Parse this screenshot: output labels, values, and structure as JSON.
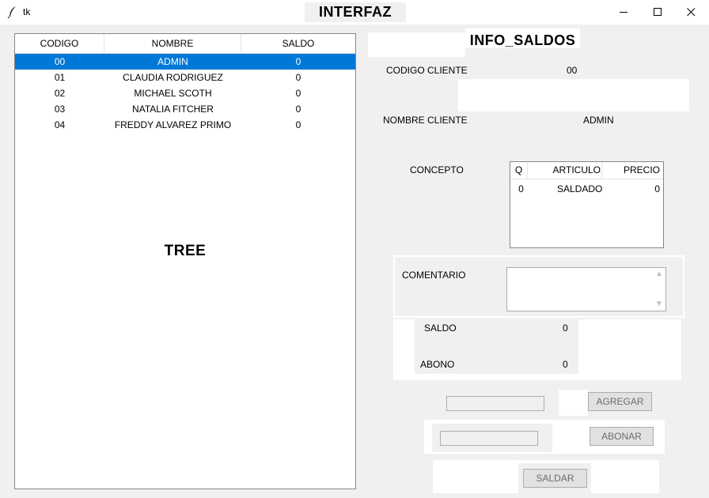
{
  "window": {
    "tk_label": "tk",
    "title": "INTERFAZ"
  },
  "tree": {
    "columns": [
      "CODIGO",
      "NOMBRE",
      "SALDO"
    ],
    "rows": [
      {
        "codigo": "00",
        "nombre": "ADMIN",
        "saldo": "0",
        "selected": true
      },
      {
        "codigo": "01",
        "nombre": "CLAUDIA RODRIGUEZ",
        "saldo": "0"
      },
      {
        "codigo": "02",
        "nombre": "MICHAEL SCOTH",
        "saldo": "0"
      },
      {
        "codigo": "03",
        "nombre": "NATALIA FITCHER",
        "saldo": "0"
      },
      {
        "codigo": "04",
        "nombre": "FREDDY ALVAREZ PRIMO",
        "saldo": "0"
      }
    ],
    "label": "TREE"
  },
  "info": {
    "title": "INFO_SALDOS",
    "codigo_cliente_label": "CODIGO CLIENTE",
    "codigo_cliente_value": "00",
    "nombre_cliente_label": "NOMBRE CLIENTE",
    "nombre_cliente_value": "ADMIN",
    "concepto_label": "CONCEPTO",
    "concepto": {
      "columns": [
        "Q",
        "ARTICULO",
        "PRECIO"
      ],
      "rows": [
        {
          "q": "0",
          "articulo": "SALDADO",
          "precio": "0"
        }
      ]
    },
    "comentario_label": "COMENTARIO",
    "comentario_value": "",
    "saldo_label": "SALDO",
    "saldo_value": "0",
    "abono_label": "ABONO",
    "abono_value": "0"
  },
  "actions": {
    "agregar_entry": "",
    "agregar_label": "AGREGAR",
    "abonar_entry": "",
    "abonar_label": "ABONAR",
    "saldar_label": "SALDAR"
  },
  "colors": {
    "selection": "#0078d7",
    "background": "#f0f0f0",
    "button_text_disabled": "#6d6d6d"
  }
}
